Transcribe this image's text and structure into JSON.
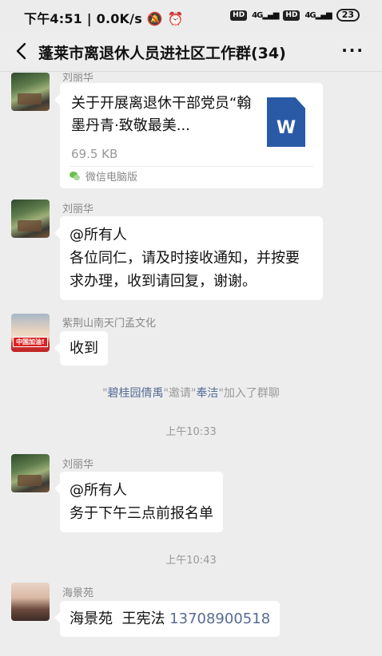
{
  "status_bar": {
    "time": "下午4:51",
    "network_speed": "0.0K/s",
    "hd1": "HD",
    "net1": "4G",
    "hd2": "HD",
    "net2": "4G",
    "battery": "23",
    "icons": [
      "silent-bell-icon",
      "alarm-icon",
      "signal-icon",
      "battery-icon"
    ]
  },
  "nav": {
    "title": "蓬莱市离退休人员进社区工作群(34)",
    "more": "···"
  },
  "messages": [
    {
      "type": "file",
      "sender": "刘丽华",
      "file_title": "关于开展离退休干部党员“翰墨丹青·致敬最美...",
      "file_size": "69.5 KB",
      "file_icon_letter": "W",
      "source": "微信电脑版"
    },
    {
      "type": "text",
      "sender": "刘丽华",
      "lines": [
        "@所有人",
        "各位同仁，请及时接收通知，并按要",
        "求办理，收到请回复，谢谢。"
      ]
    },
    {
      "type": "text",
      "sender": "紫荆山南天门孟文化",
      "avatar_tag": "中国加油!",
      "lines": [
        "收到"
      ]
    }
  ],
  "system_message": {
    "q1": "\"",
    "inviter": "碧桂园倩禹",
    "mid": "\"邀请\"",
    "invitee": "奉洁",
    "tail": "\"加入了群聊"
  },
  "timestamps": [
    "上午10:33",
    "上午10:43"
  ],
  "messages2": [
    {
      "type": "text",
      "sender": "刘丽华",
      "lines": [
        "@所有人",
        "务于下午三点前报名单"
      ]
    },
    {
      "type": "text",
      "sender": "海景苑",
      "prefix": "海景苑  王宪法 ",
      "phone": "13708900518"
    }
  ],
  "colors": {
    "background": "#ededed",
    "bubble": "#ffffff",
    "link": "#576b95",
    "word_icon": "#2a5aa6"
  }
}
